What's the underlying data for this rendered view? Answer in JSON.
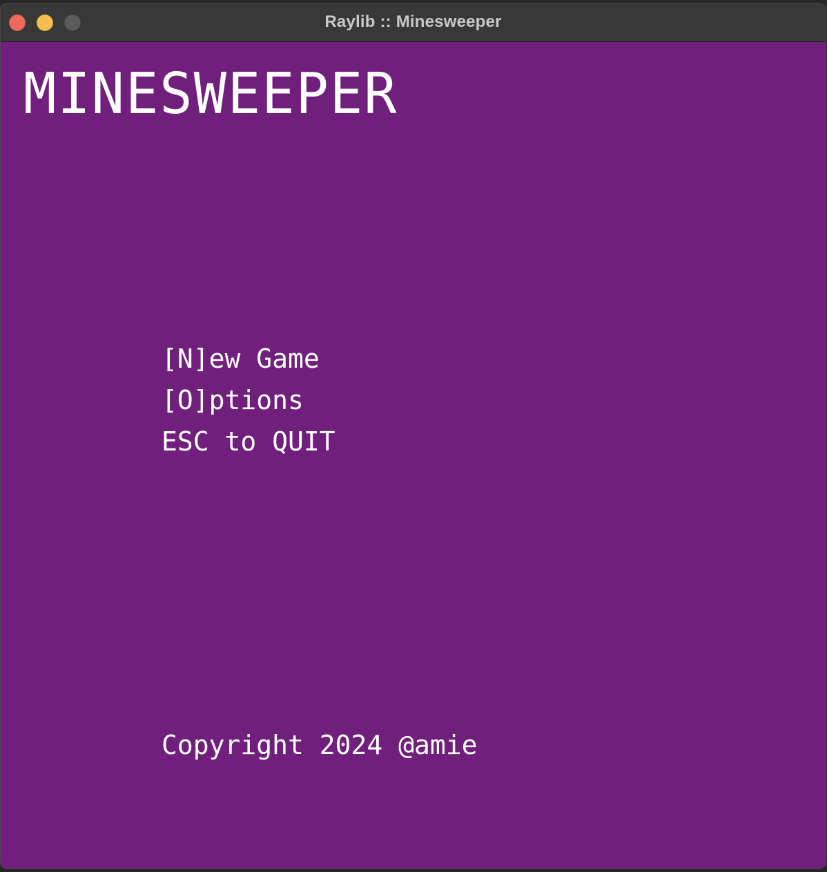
{
  "window": {
    "title": "Raylib :: Minesweeper"
  },
  "game": {
    "title": "MINESWEEPER",
    "menu": {
      "new_game": "[N]ew Game",
      "options": "[O]ptions",
      "quit": "ESC to QUIT"
    },
    "copyright": "Copyright 2024 @amie"
  },
  "colors": {
    "background": "#701f7c",
    "text": "#ffffff",
    "titlebar": "#383838"
  },
  "icons": {
    "close": "close-button-red-circle",
    "minimize": "minimize-button-yellow-circle",
    "zoom": "zoom-button-gray-circle"
  }
}
